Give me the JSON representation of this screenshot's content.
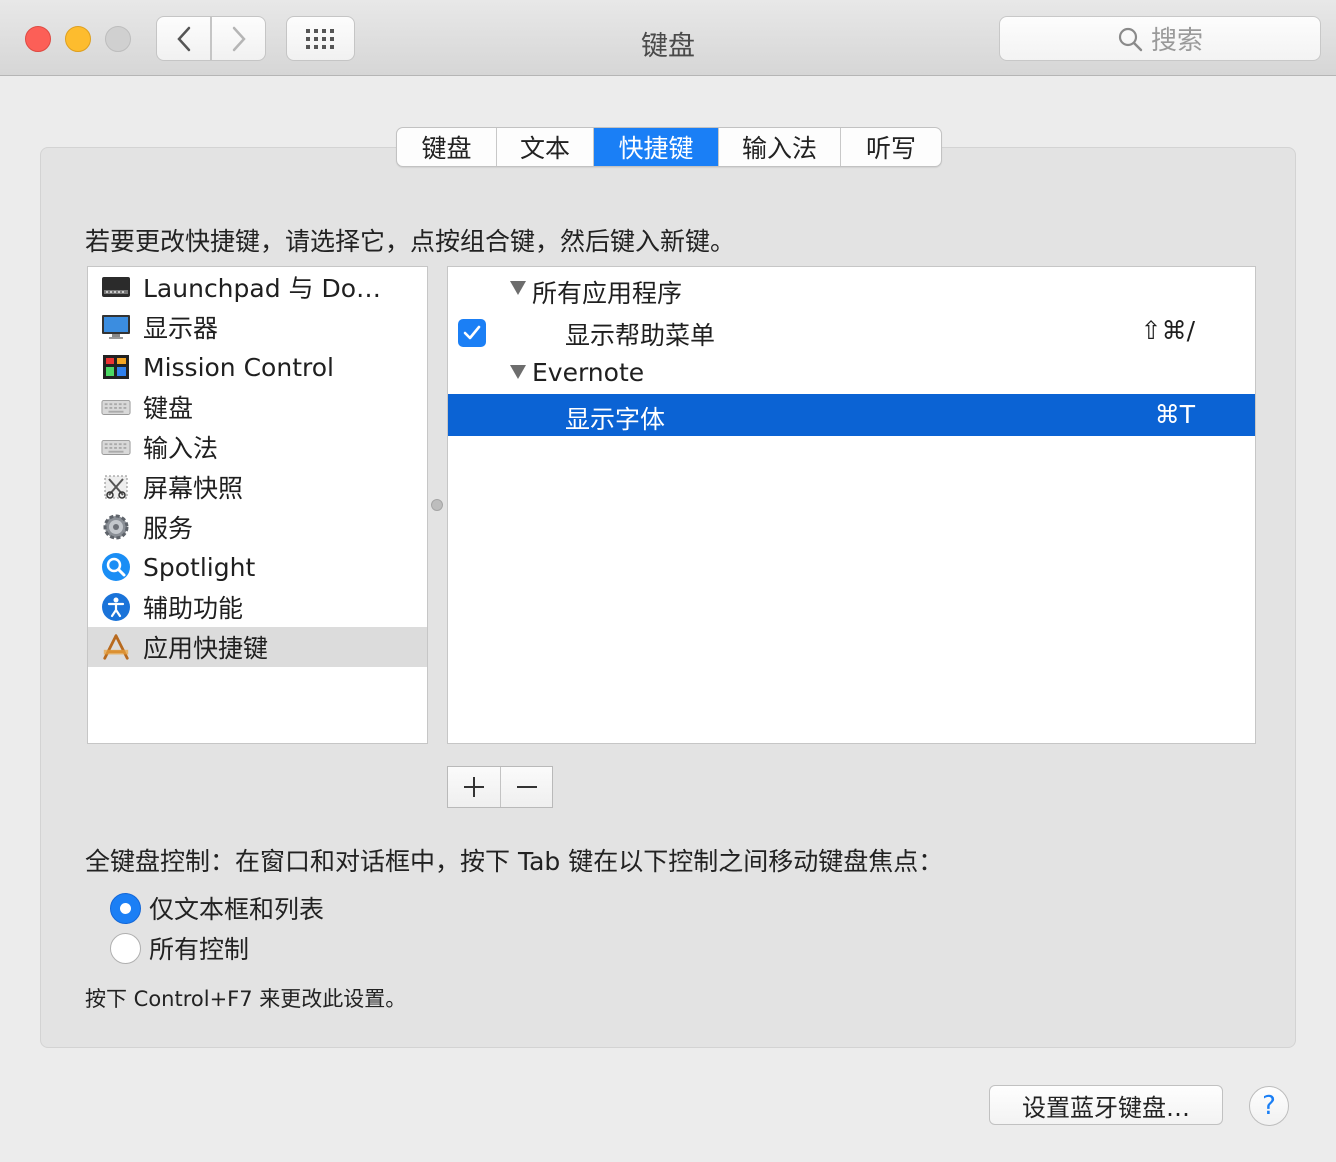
{
  "window": {
    "title": "键盘"
  },
  "search": {
    "placeholder": "搜索"
  },
  "tabs": [
    {
      "label": "键盘",
      "active": false
    },
    {
      "label": "文本",
      "active": false
    },
    {
      "label": "快捷键",
      "active": true
    },
    {
      "label": "输入法",
      "active": false
    },
    {
      "label": "听写",
      "active": false
    }
  ],
  "instruction": "若要更改快捷键，请选择它，点按组合键，然后键入新键。",
  "categories": [
    {
      "label": "Launchpad 与 Do…",
      "icon": "launchpad-icon",
      "selected": false
    },
    {
      "label": "显示器",
      "icon": "display-icon",
      "selected": false
    },
    {
      "label": "Mission Control",
      "icon": "mission-control-icon",
      "selected": false
    },
    {
      "label": "键盘",
      "icon": "keyboard-icon",
      "selected": false
    },
    {
      "label": "输入法",
      "icon": "keyboard-icon",
      "selected": false
    },
    {
      "label": "屏幕快照",
      "icon": "screenshot-icon",
      "selected": false
    },
    {
      "label": "服务",
      "icon": "gear-icon",
      "selected": false
    },
    {
      "label": "Spotlight",
      "icon": "spotlight-icon",
      "selected": false
    },
    {
      "label": "辅助功能",
      "icon": "accessibility-icon",
      "selected": false
    },
    {
      "label": "应用快捷键",
      "icon": "app-shortcuts-icon",
      "selected": true
    }
  ],
  "shortcuts": {
    "group_all": "所有应用程序",
    "item_help": {
      "label": "显示帮助菜单",
      "keys": "⇧⌘/",
      "checked": true
    },
    "group_evernote": "Evernote",
    "item_fonts": {
      "label": "显示字体",
      "keys": "⌘T",
      "selected": true
    }
  },
  "buttons": {
    "add": "+",
    "remove": "—",
    "bluetooth": "设置蓝牙键盘…",
    "help": "?"
  },
  "full_keyboard_access": {
    "label": "全键盘控制：在窗口和对话框中，按下 Tab 键在以下控制之间移动键盘焦点：",
    "options": [
      {
        "label": "仅文本框和列表",
        "selected": true
      },
      {
        "label": "所有控制",
        "selected": false
      }
    ],
    "hint": "按下 Control+F7 来更改此设置。"
  },
  "colors": {
    "accent": "#1a7ff6",
    "selection": "#0b63d4"
  }
}
